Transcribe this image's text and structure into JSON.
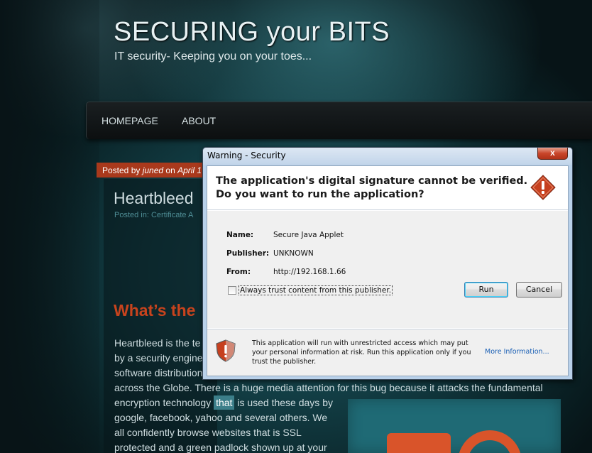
{
  "blog": {
    "title": "SECURING your BITS",
    "tagline": "IT security- Keeping you on your toes...",
    "nav": [
      "HOMEPAGE",
      "ABOUT"
    ],
    "post_meta_prefix": "Posted by ",
    "post_meta_author": "juned",
    "post_meta_on": " on ",
    "post_meta_date": "April 1",
    "post_title": "Heartbleed",
    "posted_in": "Posted in: Certificate A",
    "section_heading": "What’s the",
    "body_lines": {
      "l1": "Heartbleed is the te",
      "l2": "by a security engine",
      "l3": "software distribution",
      "l4": "across the Globe. There is a huge media attention for this bug because it attacks the fundamental",
      "l5_a": "encryption technology ",
      "l5_hl": "that",
      "l5_b": " is used these days by",
      "l6": "google, facebook, yahoo and several others. We",
      "l7": "all confidently browse websites that is SSL",
      "l8": "protected and a green padlock shown up at your"
    }
  },
  "dialog": {
    "title": "Warning - Security",
    "close_glyph": "x",
    "headline_1": "The application's digital signature cannot be verified.",
    "headline_2": "Do you want to run the application?",
    "fields": {
      "name_label": "Name:",
      "name_value": "Secure Java Applet",
      "publisher_label": "Publisher:",
      "publisher_value": "UNKNOWN",
      "from_label": "From:",
      "from_value": "http://192.168.1.66"
    },
    "checkbox_label": "Always trust content from this publisher.",
    "run_label": "Run",
    "cancel_label": "Cancel",
    "footer_text": "This application will run with unrestricted access which may put your personal information at risk. Run this application only if you trust the publisher.",
    "more_info": "More Information..."
  },
  "icons": {
    "warning": "warning-diamond-icon",
    "shield": "shield-warning-icon"
  },
  "colors": {
    "accent_red": "#c8431d",
    "meta_bar": "#a9391c",
    "dialog_frame": "#b9d1ea",
    "link_blue": "#1a5fb4"
  }
}
